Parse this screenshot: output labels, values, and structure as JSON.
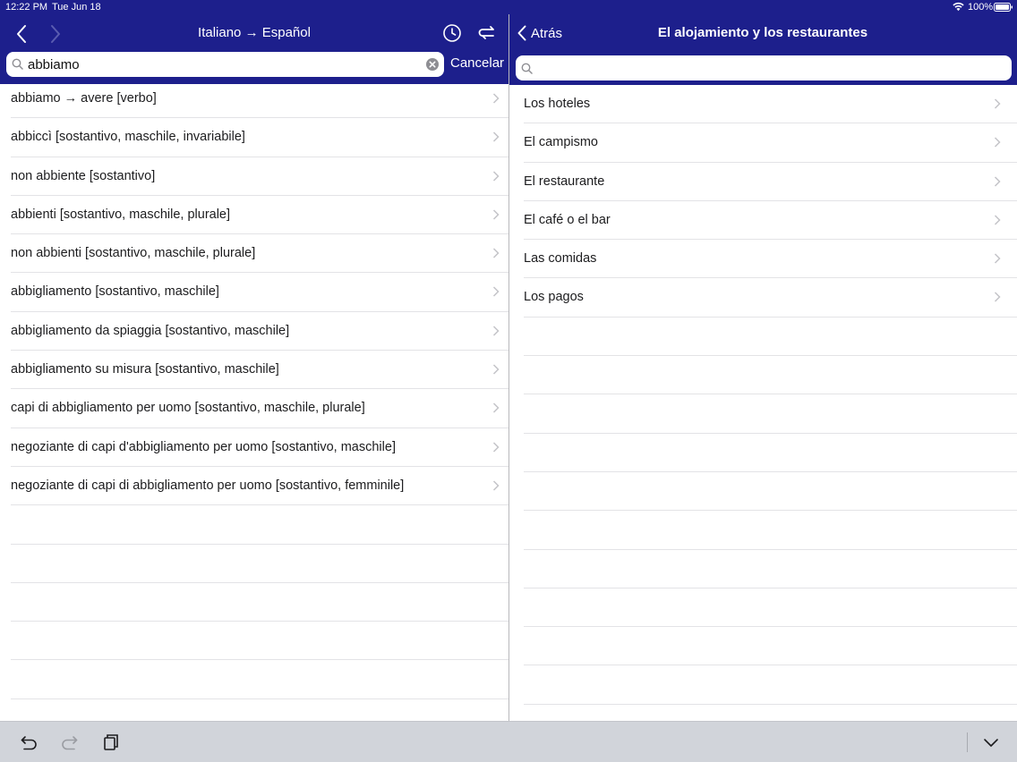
{
  "status_bar": {
    "time": "12:22 PM",
    "date": "Tue Jun 18",
    "battery": "100%"
  },
  "left": {
    "title": "Italiano → Español",
    "search": {
      "value": "abbiamo",
      "placeholder": ""
    },
    "cancel_label": "Cancelar",
    "results": [
      "abbiamo → avere [verbo]",
      "abbiccì [sostantivo, maschile, invariabile]",
      "non abbiente [sostantivo]",
      "abbienti [sostantivo, maschile, plurale]",
      "non abbienti [sostantivo, maschile, plurale]",
      "abbigliamento [sostantivo, maschile]",
      "abbigliamento da spiaggia [sostantivo, maschile]",
      "abbigliamento su misura [sostantivo, maschile]",
      "capi di abbigliamento per uomo [sostantivo, maschile, plurale]",
      "negoziante di capi d'abbigliamento per uomo [sostantivo, maschile]",
      "negoziante di capi di abbigliamento per uomo [sostantivo, femminile]"
    ]
  },
  "right": {
    "back_label": "Atrás",
    "title": "El alojamiento y los restaurantes",
    "search": {
      "value": "",
      "placeholder": ""
    },
    "topics": [
      "Los hoteles",
      "El campismo",
      "El restaurante",
      "El café o el bar",
      "Las comidas",
      "Los pagos"
    ]
  },
  "colors": {
    "header": "#1d1f8c",
    "toolbar": "#d1d4da",
    "separator": "#e3e3e6"
  }
}
